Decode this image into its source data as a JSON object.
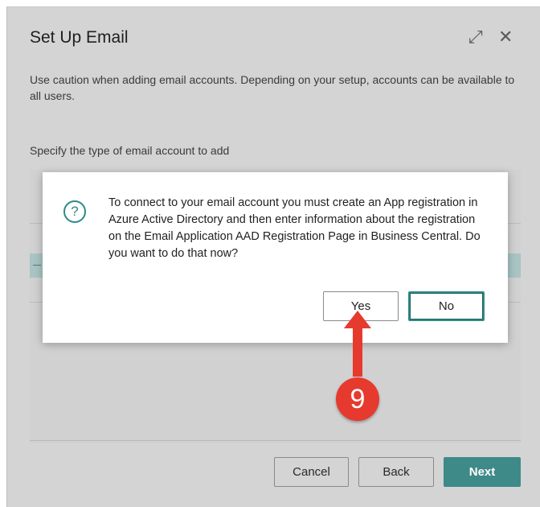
{
  "window": {
    "title": "Set Up Email",
    "expand_icon": "expand-icon",
    "close_icon": "close-icon"
  },
  "main": {
    "caution_text": "Use caution when adding email accounts. Depending on your setup, accounts can be available to all users.",
    "specify_text": "Specify the type of email account to add"
  },
  "footer": {
    "cancel_label": "Cancel",
    "back_label": "Back",
    "next_label": "Next"
  },
  "dialog": {
    "icon": "question-icon",
    "icon_glyph": "?",
    "message": "To connect to your email account you must create an App registration in Azure Active Directory and then enter information about the registration on the Email Application AAD Registration Page in Business Central. Do you want to do that now?",
    "yes_label": "Yes",
    "no_label": "No"
  },
  "annotation": {
    "step_number": "9",
    "color": "#e63a2e"
  },
  "colors": {
    "accent": "#3e8a88",
    "overlay_bg": "#d4d4d4",
    "selected_row": "#a9c4c4"
  }
}
